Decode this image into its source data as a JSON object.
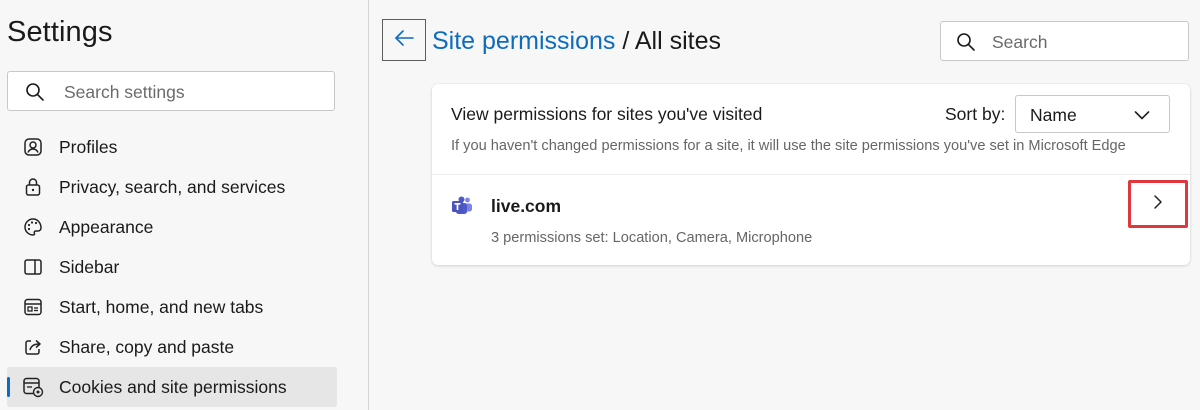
{
  "sidebar": {
    "title": "Settings",
    "search_placeholder": "Search settings",
    "items": [
      {
        "label": "Profiles",
        "icon": "profile-icon"
      },
      {
        "label": "Privacy, search, and services",
        "icon": "lock-icon"
      },
      {
        "label": "Appearance",
        "icon": "palette-icon"
      },
      {
        "label": "Sidebar",
        "icon": "sidebar-icon"
      },
      {
        "label": "Start, home, and new tabs",
        "icon": "home-tabs-icon"
      },
      {
        "label": "Share, copy and paste",
        "icon": "share-icon"
      },
      {
        "label": "Cookies and site permissions",
        "icon": "cookie-settings-icon",
        "selected": true
      }
    ]
  },
  "header": {
    "breadcrumb_link": "Site permissions",
    "breadcrumb_sep": " / ",
    "breadcrumb_current": "All sites",
    "search_placeholder": "Search"
  },
  "card": {
    "title": "View permissions for sites you've visited",
    "sort_label": "Sort by:",
    "sort_value": "Name",
    "description": "If you haven't changed permissions for a site, it will use the site permissions you've set in Microsoft Edge",
    "sites": [
      {
        "name": "live.com",
        "permissions": "3 permissions set: Location, Camera, Microphone",
        "icon": "teams-icon"
      }
    ]
  },
  "colors": {
    "accent": "#0f6cbd",
    "highlight_box": "#e0373f",
    "selected_bg": "#e6e6e6"
  }
}
